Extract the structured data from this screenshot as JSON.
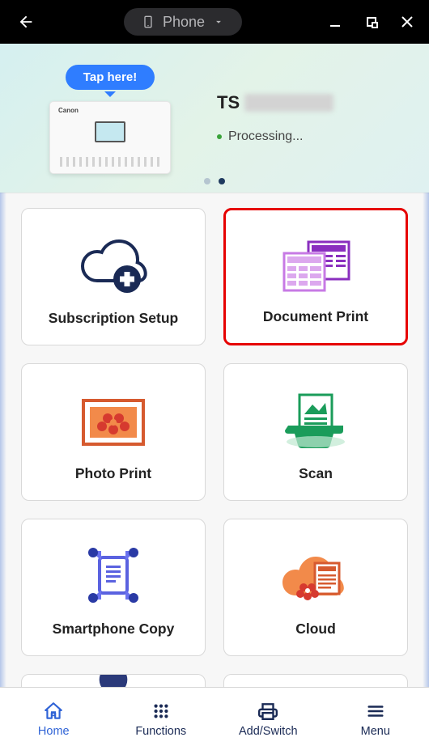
{
  "titlebar": {
    "device_label": "Phone"
  },
  "hero": {
    "tooltip": "Tap here!",
    "printer_brand": "Canon",
    "printer_prefix": "TS",
    "status": "Processing..."
  },
  "cards": [
    {
      "label": "Subscription Setup"
    },
    {
      "label": "Document Print"
    },
    {
      "label": "Photo Print"
    },
    {
      "label": "Scan"
    },
    {
      "label": "Smartphone Copy"
    },
    {
      "label": "Cloud"
    }
  ],
  "nav": {
    "home": "Home",
    "functions": "Functions",
    "addswitch": "Add/Switch",
    "menu": "Menu"
  }
}
